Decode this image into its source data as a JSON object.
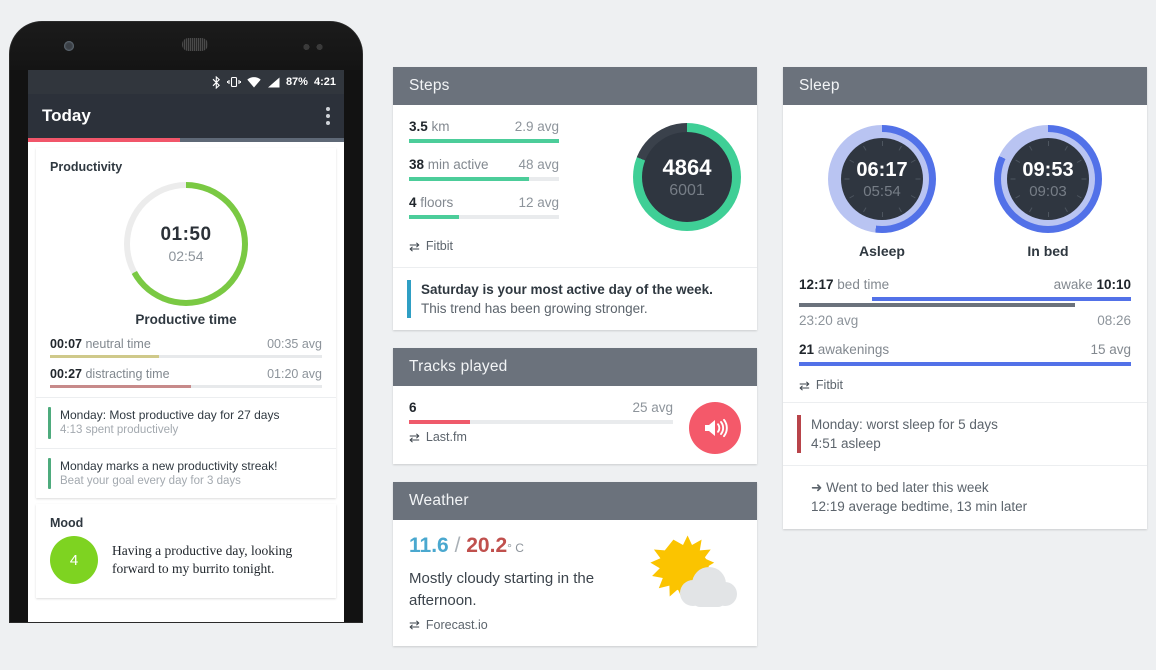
{
  "phone": {
    "statusbar": {
      "icons": [
        "bluetooth-icon",
        "vibrate-icon",
        "wifi-icon",
        "signal-icon"
      ],
      "battery": "87%",
      "clock": "4:21"
    },
    "appbar": {
      "title": "Today",
      "overflow": "overflow-menu-icon"
    },
    "progress_percent": 48,
    "productivity": {
      "title": "Productivity",
      "donut": {
        "value": "01:50",
        "average": "02:54",
        "percent": 67,
        "color": "#7ac943"
      },
      "label": "Productive time",
      "metrics": [
        {
          "value": "00:07",
          "name": "neutral time",
          "avg": "00:35 avg",
          "fill": 40,
          "color": "#cfc98a"
        },
        {
          "value": "00:27",
          "name": "distracting time",
          "avg": "01:20 avg",
          "fill": 52,
          "color": "#c78a8a"
        }
      ],
      "insights": [
        {
          "title": "Monday: Most productive day for 27 days",
          "sub": "4:13 spent productively",
          "accent": "#4eab7d"
        },
        {
          "title": "Monday marks a new productivity streak!",
          "sub": "Beat your goal every day for 3 days",
          "accent": "#4eab7d"
        }
      ]
    },
    "mood": {
      "title": "Mood",
      "score": "4",
      "score_color": "#7ed321",
      "note": "Having a productive day, looking forward to my burrito tonight."
    }
  },
  "cards": {
    "steps": {
      "title": "Steps",
      "metrics": [
        {
          "value": "3.5",
          "name": "km",
          "avg": "2.9 avg",
          "fill": 100
        },
        {
          "value": "38",
          "name": "min active",
          "avg": "48 avg",
          "fill": 80
        },
        {
          "value": "4",
          "name": "floors",
          "avg": "12 avg",
          "fill": 33
        }
      ],
      "bar_color": "#4ccd9a",
      "ring": {
        "value": "4864",
        "goal": "6001",
        "percent": 81,
        "color": "#3fcf96"
      },
      "source": {
        "icon": "sync-icon",
        "label": "Fitbit"
      },
      "insight": {
        "line1": "Saturday is your most active day of the week.",
        "line2": "This trend has been growing stronger.",
        "accent": "#2f9fc4"
      }
    },
    "tracks": {
      "title": "Tracks played",
      "value": "6",
      "avg": "25 avg",
      "fill": 23,
      "bar_color": "#ef5a6b",
      "icon": "volume-icon",
      "icon_bg": "#f4596a",
      "source": {
        "icon": "sync-icon",
        "label": "Last.fm"
      }
    },
    "weather": {
      "title": "Weather",
      "low": "11.6",
      "separator": "/",
      "high": "20.2",
      "unit": "° C",
      "description": "Mostly cloudy starting in the afternoon.",
      "icon": "sun-behind-cloud-icon",
      "sun_color": "#fbc400",
      "cloud_color": "#e2e4e6",
      "source": {
        "icon": "sync-icon",
        "label": "Forecast.io"
      }
    },
    "sleep": {
      "title": "Sleep",
      "dials": [
        {
          "value": "06:17",
          "average": "05:54",
          "label": "Asleep",
          "percent": 52
        },
        {
          "value": "09:53",
          "average": "09:03",
          "label": "In bed",
          "percent": 82
        }
      ],
      "dial_color": "#5271e8",
      "dial_ring_color": "#b9c4f2",
      "bedtime": {
        "left_value": "12:17",
        "left_label": "bed time",
        "right_label": "awake",
        "right_value": "10:10",
        "bar_start": 22,
        "bar_end": 100,
        "avg_bar_start": 0,
        "avg_bar_end": 83,
        "avg_left": "23:20 avg",
        "avg_right": "08:26"
      },
      "awakenings": {
        "value": "21",
        "name": "awakenings",
        "avg": "15 avg",
        "fill": 100
      },
      "source": {
        "icon": "sync-icon",
        "label": "Fitbit"
      },
      "insights": [
        {
          "line1": "Monday: worst sleep for 5 days",
          "line2": "4:51 asleep",
          "accent": "#b8444a",
          "arrow": ""
        },
        {
          "line1": "Went to bed later this week",
          "line2": "12:19 average bedtime, 13 min later",
          "accent": "",
          "arrow": "➜"
        }
      ]
    }
  }
}
